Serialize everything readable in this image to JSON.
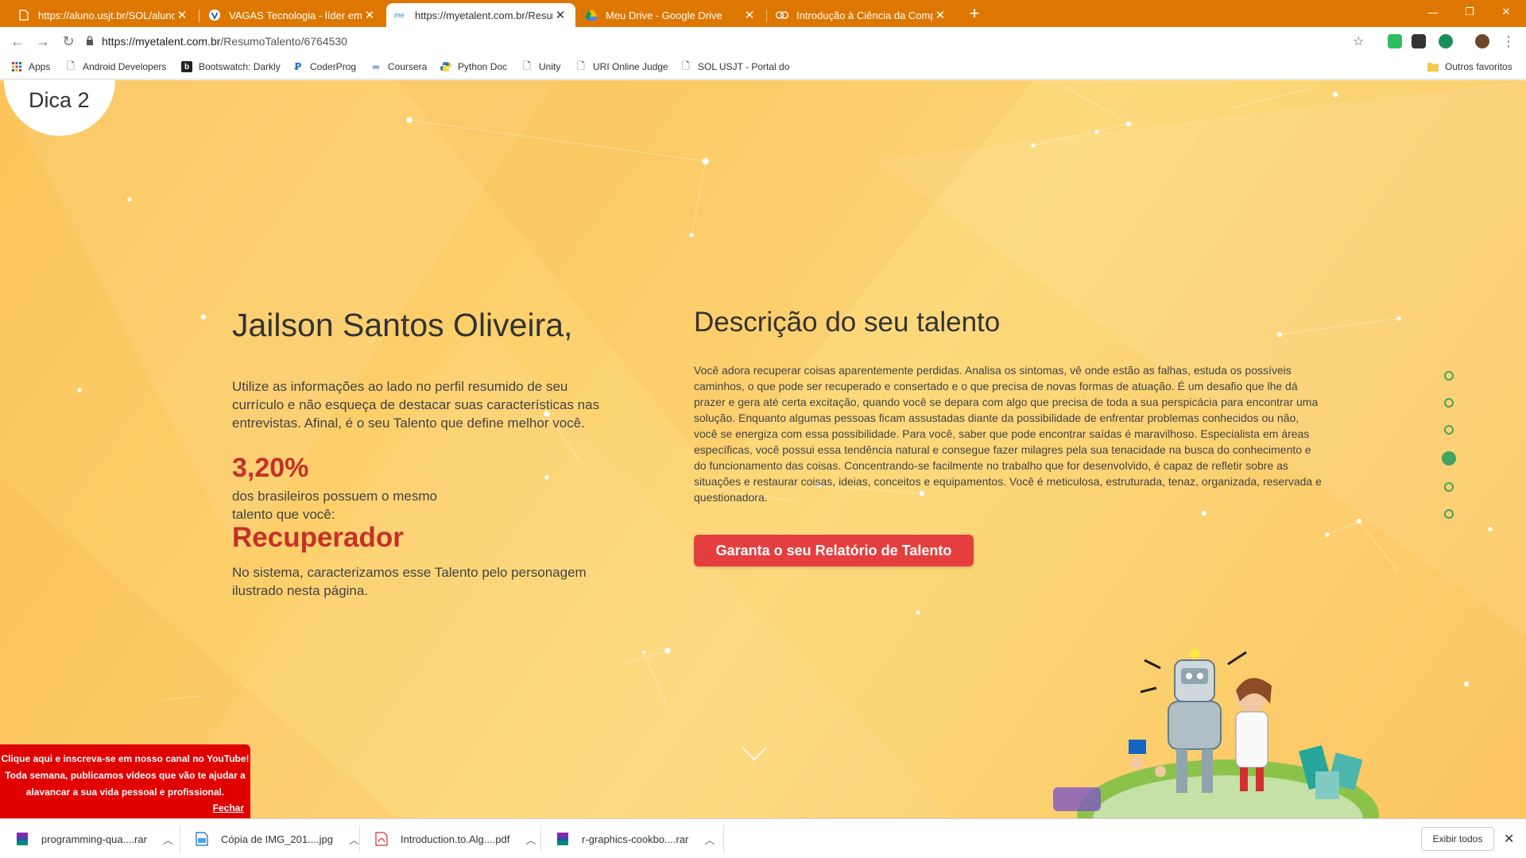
{
  "browser": {
    "tabs": [
      {
        "title": "https://aluno.usjt.br/SOL/aluno/i",
        "active": false
      },
      {
        "title": "VAGAS Tecnologia - líder em sol",
        "active": false
      },
      {
        "title": "https://myetalent.com.br/Resum",
        "active": true
      },
      {
        "title": "Meu Drive - Google Drive",
        "active": false
      },
      {
        "title": "Introdução à Ciência da Comput",
        "active": false
      }
    ],
    "url_host": "https://myetalent.com.br",
    "url_path": "/ResumoTalento/6764530",
    "bookmarks": [
      "Apps",
      "Android Developers",
      "Bootswatch: Darkly",
      "CoderProg",
      "Coursera",
      "Python Doc",
      "Unity",
      "URI Online Judge",
      "SOL USJT - Portal do"
    ],
    "other_bookmarks": "Outros favoritos",
    "accent_color": "#dd7700"
  },
  "page": {
    "tip_label": "Dica 2",
    "user_name": "Jailson Santos Oliveira,",
    "intro_text": "Utilize as informações ao lado no perfil resumido de seu currículo e não esqueça de destacar suas características nas entrevistas. Afinal, é o seu Talento que define melhor você.",
    "percentage": "3,20%",
    "percentage_text_1": "dos brasileiros possuem o mesmo",
    "percentage_text_2": "talento que você:",
    "talent_name": "Recuperador",
    "system_text": "No sistema, caracterizamos esse Talento pelo personagem ilustrado nesta página.",
    "description_title": "Descrição do seu talento",
    "description": "Você adora recuperar coisas aparentemente perdidas. Analisa os sintomas, vê onde estão as falhas, estuda os possíveis caminhos, o que pode ser recuperado e consertado e o que precisa de novas formas de atuação. É um desafio que lhe dá prazer e gera até certa excitação, quando você se depara com algo que precisa de toda a sua perspicácia para encontrar uma solução. Enquanto algumas pessoas ficam assustadas diante da possibilidade de enfrentar problemas conhecidos ou não, você se energiza com essa possibilidade. Para você, saber que pode encontrar saídas é maravilhoso. Especialista em áreas específicas, você possui essa tendência natural e consegue fazer milagres pela sua tenacidade na busca do conhecimento e do funcionamento das coisas. Concentrando-se facilmente no trabalho que for desenvolvido, é capaz de refletir sobre as situações e restaurar coisas, ideias, conceitos e equipamentos. Você é meticulosa, estruturada, tenaz, organizada, reservada e questionadora.",
    "cta_label": "Garanta o seu Relatório de Talento",
    "pager_active_index": 4,
    "pager_count": 6,
    "youtube_banner": {
      "line1": "Clique aqui e inscreva-se em nosso canal no YouTube!",
      "line2": "Toda semana, publicamos vídeos que vão te ajudar a",
      "line3": "alavancar a sua vida pessoal e profissional.",
      "close": "Fechar"
    },
    "colors": {
      "highlight": "#c53029",
      "cta": "#e53e3e",
      "pager": "#44a35c",
      "banner": "#e00000"
    }
  },
  "downloads": {
    "items": [
      "programming-qua....rar",
      "Cópia de IMG_201....jpg",
      "Introduction.to.Alg....pdf",
      "r-graphics-cookbo....rar"
    ],
    "show_all": "Exibir todos"
  }
}
